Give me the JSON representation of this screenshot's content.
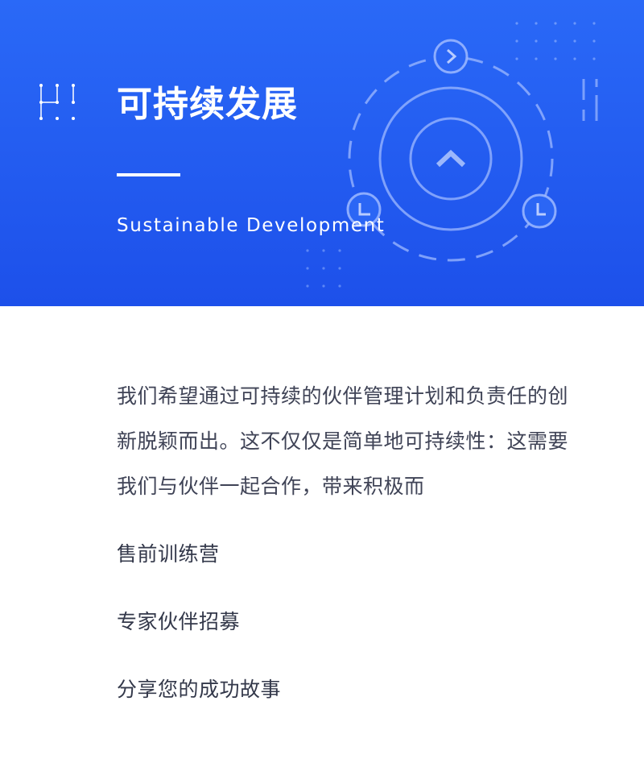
{
  "hero": {
    "title": "可持续发展",
    "subtitle": "Sustainable Development",
    "background_color": "#2563f5"
  },
  "description": "我们希望通过可持续的伙伴管理计划和负责任的创新脱颖而出。这不仅仅是简单地可持续性：这需要我们与伙伴一起合作，带来积极而",
  "links": [
    {
      "label": "售前训练营"
    },
    {
      "label": "专家伙伴招募"
    },
    {
      "label": "分享您的成功故事"
    }
  ]
}
